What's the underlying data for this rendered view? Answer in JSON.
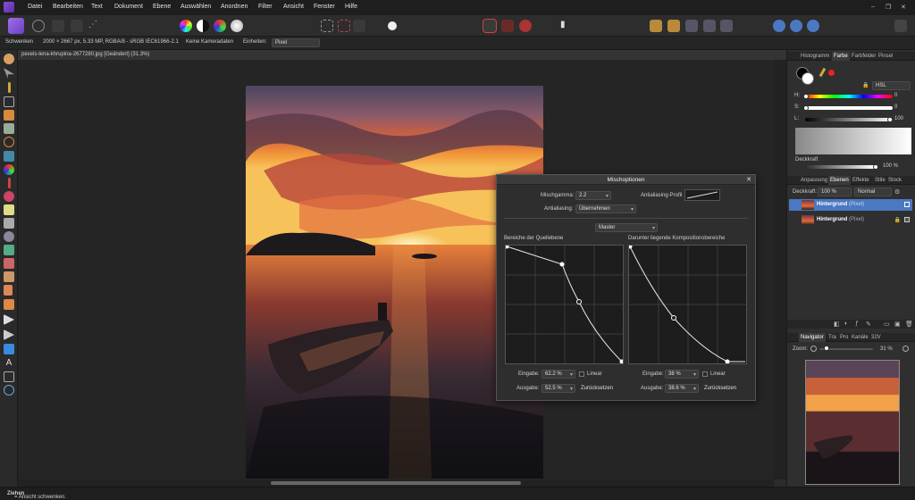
{
  "menu": [
    "Datei",
    "Bearbeiten",
    "Text",
    "Dokument",
    "Ebene",
    "Auswählen",
    "Anordnen",
    "Filter",
    "Ansicht",
    "Fenster",
    "Hilfe"
  ],
  "context": {
    "tool": "Schwenken",
    "doc_info": "2000 × 2667 px, 5.33 MP, RGBA/8 - sRGB IEC61966-2.1",
    "camera": "Keine Kameradaten",
    "units_label": "Einheiten:",
    "units_value": "Pixel"
  },
  "document_tab": "pexels-lena-khrupina-2677280.jpg [Geändert] (31.3%)",
  "status_text": "Ziehen = Ansicht schwenken.",
  "status_bold": "Ziehen",
  "status_rest": " = Ansicht schwenken.",
  "panel_tabs_top": [
    "Histogramm",
    "Farbe",
    "Farbfelder",
    "Pinsel"
  ],
  "color": {
    "model": "HSL",
    "h_label": "H:",
    "h_value": "0",
    "s_label": "S:",
    "s_value": "0",
    "l_label": "L:",
    "l_value": "100",
    "opacity_label": "Deckkraft",
    "opacity_value": "100 %"
  },
  "panel_tabs_mid": [
    "Anpassung",
    "Ebenen",
    "Effekte",
    "Stile",
    "Stock"
  ],
  "layers": {
    "opacity_label": "Deckkraft:",
    "opacity_value": "100 %",
    "blend_mode": "Normal",
    "items": [
      {
        "name": "Hintergrund",
        "type": "(Pixel)"
      },
      {
        "name": "Hintergrund",
        "type": "(Pixel)"
      }
    ]
  },
  "panel_tabs_bottom": [
    "Navigator",
    "Tra",
    "Pro",
    "Kanäle",
    "32V"
  ],
  "navigator": {
    "zoom_label": "Zoom:",
    "zoom_value": "31 %"
  },
  "dialog": {
    "title": "Mischoptionen",
    "gamma_label": "Mischgamma:",
    "gamma_value": "2.2",
    "aa_profile_label": "Antialiasing-Profil",
    "aa_label": "Antialiasing:",
    "aa_value": "Übernehmen",
    "channel": "Master",
    "source_title": "Bereiche der Quellebene",
    "dest_title": "Darunter liegende Kompositionsbereiche",
    "left": {
      "input_label": "Eingabe:",
      "input_value": "62.2 %",
      "output_label": "Ausgabe:",
      "output_value": "52.5 %",
      "linear": "Linear",
      "reset": "Zurücksetzen"
    },
    "right": {
      "input_label": "Eingabe:",
      "input_value": "38 %",
      "output_label": "Ausgabe:",
      "output_value": "38.6 %",
      "linear": "Linear",
      "reset": "Zurücksetzen"
    }
  },
  "colors": {
    "accent": "#4a78c2",
    "selected_layer": "#4a78c2"
  }
}
